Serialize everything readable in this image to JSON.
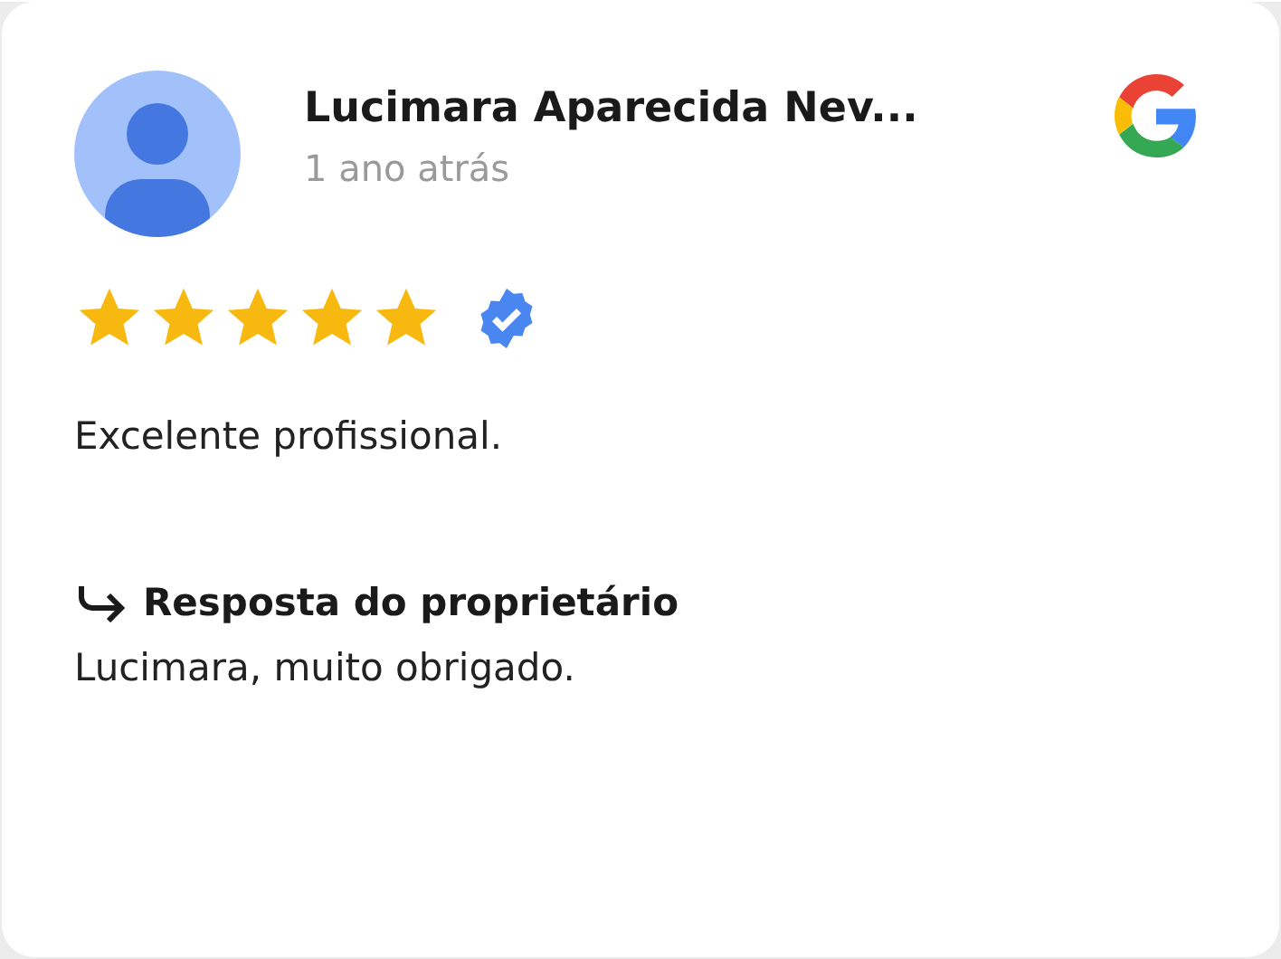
{
  "review": {
    "author": "Lucimara Aparecida Nev...",
    "date": "1 ano atrás",
    "stars": 5,
    "verified": true,
    "text": "Excelente profissional.",
    "reply": {
      "title": "Resposta do proprietário",
      "text": "Lucimara, muito obrigado."
    }
  }
}
